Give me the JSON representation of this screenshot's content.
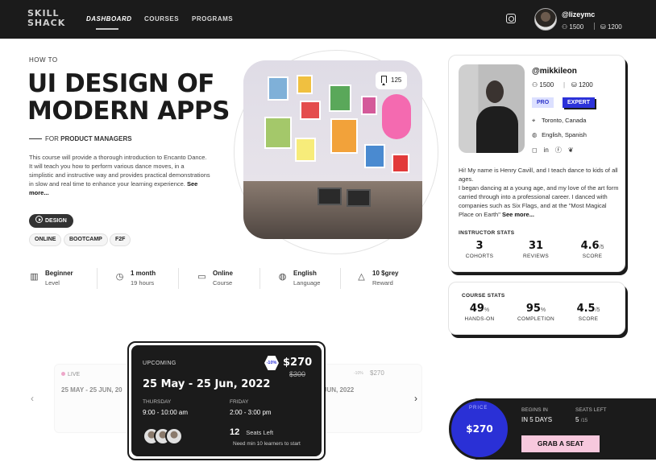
{
  "nav": {
    "logo": "SKILL SHACK",
    "links": [
      "DASHBOARD",
      "COURSES",
      "PROGRAMS"
    ],
    "user": {
      "handle": "@lizeymc",
      "points": "1500",
      "coins": "1200"
    }
  },
  "course": {
    "howto": "HOW TO",
    "title": "UI DESIGN OF MODERN APPS",
    "for_prefix": "FOR",
    "for_audience": "PRODUCT MANAGERS",
    "description": "This course will provide a thorough introduction to Encanto Dance. It will teach you how to perform various dance moves, in a simplistic and instructive way and provides practical demonstrations in slow and real time to enhance your learning experience.",
    "see_more": "See more...",
    "category": "DESIGN",
    "tags": [
      "ONLINE",
      "BOOTCAMP",
      "F2F"
    ],
    "facts": [
      {
        "value": "Beginner",
        "label": "Level",
        "icon": "book-icon"
      },
      {
        "value": "1 month",
        "label": "19 hours",
        "icon": "clock-icon"
      },
      {
        "value": "Online",
        "label": "Course",
        "icon": "cast-icon"
      },
      {
        "value": "English",
        "label": "Language",
        "icon": "globe-icon"
      },
      {
        "value": "10 $grey",
        "label": "Reward",
        "icon": "reward-icon"
      }
    ],
    "bookmarks": "125"
  },
  "instructor": {
    "handle": "@mikkileon",
    "points": "1500",
    "coins": "1200",
    "badges": [
      "PRO",
      "EXPERT"
    ],
    "location": "Toronto, Canada",
    "languages": "English, Spanish",
    "bio": "Hi! My name is Henry Cavill, and I teach dance to kids of all ages.\nI began dancing at a young age, and my love of the art form carried through into a professional career. I danced with companies such as Six Flags, and at the \"Most Magical Place on Earth\"",
    "see_more": "See more...",
    "stats_title": "INSTRUCTOR STATS",
    "stats": [
      {
        "value": "3",
        "suffix": "",
        "label": "COHORTS"
      },
      {
        "value": "31",
        "suffix": "",
        "label": "REVIEWS"
      },
      {
        "value": "4.6",
        "suffix": "/5",
        "label": "SCORE"
      }
    ]
  },
  "course_stats": {
    "title": "COURSE STATS",
    "stats": [
      {
        "value": "49",
        "suffix": "%",
        "label": "HANDS-ON"
      },
      {
        "value": "95",
        "suffix": "%",
        "label": "COMPLETION"
      },
      {
        "value": "4.5",
        "suffix": "/5",
        "label": "SCORE"
      }
    ]
  },
  "cohorts": {
    "live": {
      "label": "LIVE",
      "dates": "25 MAY - 25 JUN, 20"
    },
    "next": {
      "dates": "JUN, 2022",
      "discount": "-10%",
      "price": "$270"
    },
    "upcoming": {
      "label": "UPCOMING",
      "discount": "-10%",
      "price": "$270",
      "old_price": "$300",
      "dates": "25 May  - 25 Jun, 2022",
      "day1": "THURSDAY",
      "time1": "9:00 - 10:00 am",
      "day2": "FRIDAY",
      "time2": "2:00 - 3:00 pm",
      "seats_left": "12",
      "seats_label": "Seats Left",
      "need": "Need min 10 learners to start"
    }
  },
  "checkout": {
    "badge_text": "PRICE",
    "price": "$270",
    "begins_label": "BEGINS IN",
    "begins_value": "IN 5 DAYS",
    "seats_label": "SEATS LEFT",
    "seats_value": "5",
    "seats_total": "/15",
    "cta": "GRAB A SEAT"
  }
}
